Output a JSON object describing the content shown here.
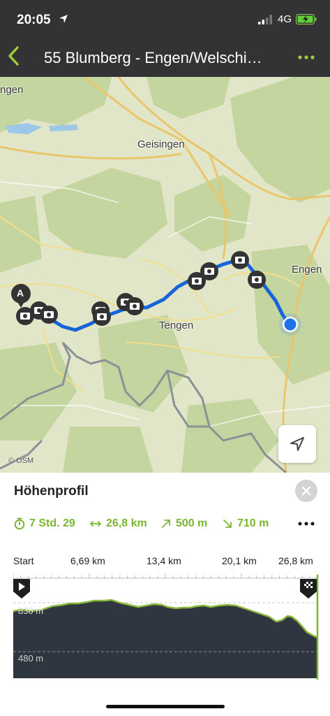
{
  "status_bar": {
    "time": "20:05",
    "network": "4G"
  },
  "header": {
    "title": "55 Blumberg - Engen/Welschi…"
  },
  "map": {
    "places": {
      "engen_top": "ngen",
      "geisingen": "Geisingen",
      "engen": "Engen",
      "tengen": "Tengen"
    },
    "start_marker": "A",
    "attribution": "© OSM"
  },
  "panel": {
    "title": "Höhenprofil",
    "stats": {
      "duration": "7 Std. 29",
      "distance": "26,8 km",
      "ascent": "500 m",
      "descent": "710 m"
    },
    "axis": {
      "start": "Start",
      "t1": "6,69 km",
      "t2": "13,4 km",
      "t3": "20,1 km",
      "t4": "26,8 km"
    },
    "elev_high": "830 m",
    "elev_low": "480 m"
  },
  "colors": {
    "accent": "#7ab62f",
    "route": "#1565d8",
    "profile_fill": "#2f3640",
    "header_bg": "#333335"
  }
}
